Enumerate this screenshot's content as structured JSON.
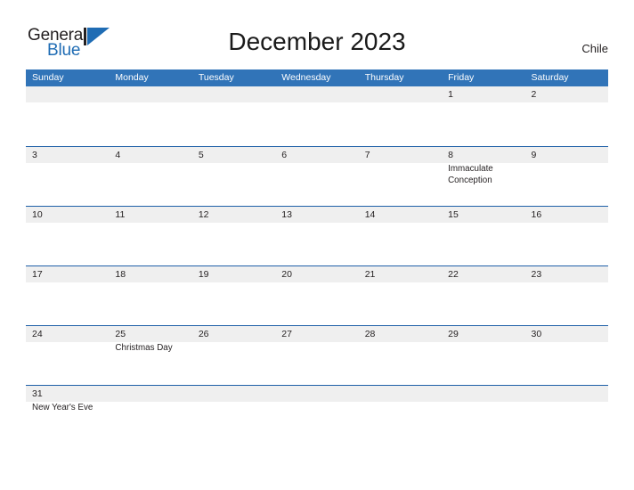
{
  "logo": {
    "word_one": "General",
    "word_two": "Blue",
    "flag_icon": "blue-flag-triangle",
    "accent_color": "#1f6cb4"
  },
  "header": {
    "title": "December 2023",
    "country": "Chile"
  },
  "colors": {
    "header_blue": "#3174b8",
    "row_divider_blue": "#1f60a8",
    "daynum_band_gray": "#efefef",
    "text": "#231f20"
  },
  "calendar": {
    "weekdays": [
      "Sunday",
      "Monday",
      "Tuesday",
      "Wednesday",
      "Thursday",
      "Friday",
      "Saturday"
    ],
    "weeks": [
      {
        "days": [
          {
            "number": "",
            "events": []
          },
          {
            "number": "",
            "events": []
          },
          {
            "number": "",
            "events": []
          },
          {
            "number": "",
            "events": []
          },
          {
            "number": "",
            "events": []
          },
          {
            "number": "1",
            "events": []
          },
          {
            "number": "2",
            "events": []
          }
        ]
      },
      {
        "days": [
          {
            "number": "3",
            "events": []
          },
          {
            "number": "4",
            "events": []
          },
          {
            "number": "5",
            "events": []
          },
          {
            "number": "6",
            "events": []
          },
          {
            "number": "7",
            "events": []
          },
          {
            "number": "8",
            "events": [
              "Immaculate Conception"
            ]
          },
          {
            "number": "9",
            "events": []
          }
        ]
      },
      {
        "days": [
          {
            "number": "10",
            "events": []
          },
          {
            "number": "11",
            "events": []
          },
          {
            "number": "12",
            "events": []
          },
          {
            "number": "13",
            "events": []
          },
          {
            "number": "14",
            "events": []
          },
          {
            "number": "15",
            "events": []
          },
          {
            "number": "16",
            "events": []
          }
        ]
      },
      {
        "days": [
          {
            "number": "17",
            "events": []
          },
          {
            "number": "18",
            "events": []
          },
          {
            "number": "19",
            "events": []
          },
          {
            "number": "20",
            "events": []
          },
          {
            "number": "21",
            "events": []
          },
          {
            "number": "22",
            "events": []
          },
          {
            "number": "23",
            "events": []
          }
        ]
      },
      {
        "days": [
          {
            "number": "24",
            "events": []
          },
          {
            "number": "25",
            "events": [
              "Christmas Day"
            ]
          },
          {
            "number": "26",
            "events": []
          },
          {
            "number": "27",
            "events": []
          },
          {
            "number": "28",
            "events": []
          },
          {
            "number": "29",
            "events": []
          },
          {
            "number": "30",
            "events": []
          }
        ]
      },
      {
        "days": [
          {
            "number": "31",
            "events": [
              "New Year's Eve"
            ]
          },
          {
            "number": "",
            "events": []
          },
          {
            "number": "",
            "events": []
          },
          {
            "number": "",
            "events": []
          },
          {
            "number": "",
            "events": []
          },
          {
            "number": "",
            "events": []
          },
          {
            "number": "",
            "events": []
          }
        ]
      }
    ]
  }
}
